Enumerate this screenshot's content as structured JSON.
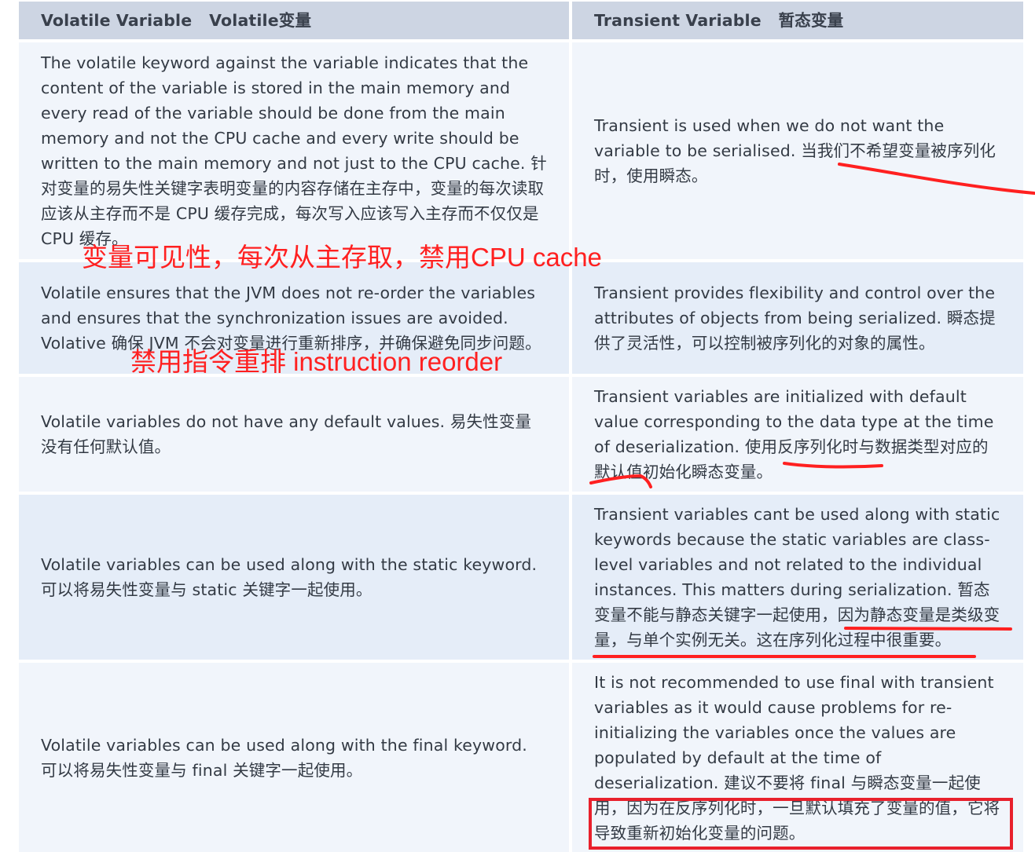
{
  "headers": {
    "left": "Volatile Variable   Volatile变量",
    "right": "Transient Variable   暂态变量"
  },
  "rows": [
    {
      "left": "The volatile keyword against the variable indicates that the content of the variable is stored in the main memory and every read of the variable should be done from the main memory and not the CPU cache and every write should be written to the main memory and not just to the CPU cache. 针对变量的易失性关键字表明变量的内容存储在主存中，变量的每次读取应该从主存而不是 CPU 缓存完成，每次写入应该写入主存而不仅仅是 CPU 缓存。",
      "right": "Transient is used when we do not want the variable to be serialised. 当我们不希望变量被序列化时，使用瞬态。"
    },
    {
      "left": "Volatile ensures that the JVM does not re-order the variables and ensures that the synchronization issues are avoided. Volative 确保 JVM 不会对变量进行重新排序，并确保避免同步问题。",
      "right": "Transient provides flexibility and control over the attributes of objects from being serialized. 瞬态提供了灵活性，可以控制被序列化的对象的属性。"
    },
    {
      "left": "Volatile variables do not have any default values. 易失性变量没有任何默认值。",
      "right": "Transient variables are initialized with default value corresponding to the data type at the time of deserialization. 使用反序列化时与数据类型对应的默认值初始化瞬态变量。"
    },
    {
      "left": "Volatile variables can be used along with the static keyword. 可以将易失性变量与 static 关键字一起使用。",
      "right": "Transient variables cant be used along with static keywords because the static variables are class-level variables and not related to the individual instances. This matters during serialization. 暂态变量不能与静态关键字一起使用，因为静态变量是类级变量，与单个实例无关。这在序列化过程中很重要。"
    },
    {
      "left": "Volatile variables can be used along with the final keyword. 可以将易失性变量与 final 关键字一起使用。",
      "right": "It is not recommended to use final with transient variables as it would cause problems for re-initializing the variables once the values are populated by default at the time of deserialization. 建议不要将 final 与瞬态变量一起使用，因为在反序列化时，一旦默认填充了变量的值，它将导致重新初始化变量的问题。"
    }
  ],
  "annotations": {
    "visibility_note": "变量可见性，每次从主存取，禁用CPU cache",
    "reorder_note": "禁用指令重排 instruction reorder"
  },
  "colors": {
    "header_bg": "#cdd5e3",
    "row_light": "#f1f5fb",
    "row_blue": "#e5edf8",
    "annotation_red": "#ff2020"
  }
}
